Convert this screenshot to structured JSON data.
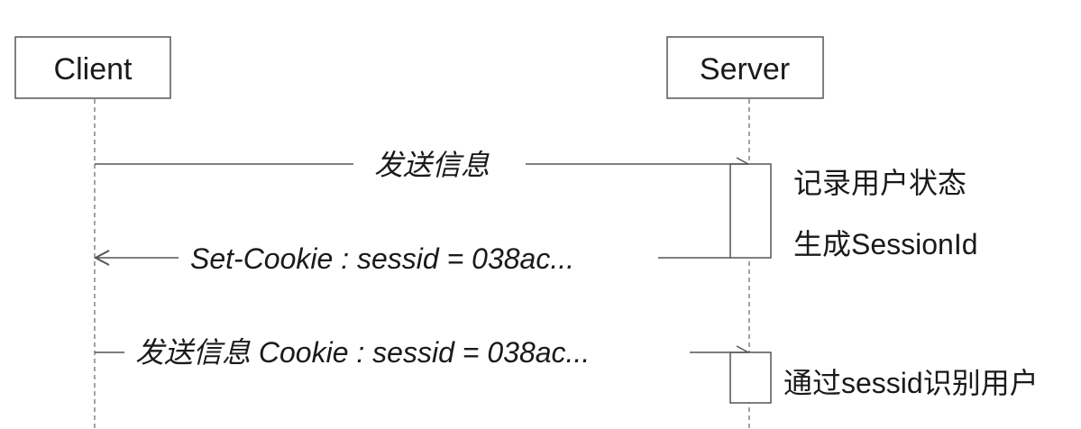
{
  "participants": {
    "client": "Client",
    "server": "Server"
  },
  "messages": [
    {
      "label": "发送信息",
      "direction": "client-to-server"
    },
    {
      "label": "Set-Cookie : sessid = 038ac...",
      "direction": "server-to-client"
    },
    {
      "label": "发送信息 Cookie : sessid = 038ac...",
      "direction": "client-to-server"
    }
  ],
  "notes": {
    "record_state": "记录用户状态",
    "generate_id": "生成SessionId",
    "identify_user": "通过sessid识别用户"
  }
}
